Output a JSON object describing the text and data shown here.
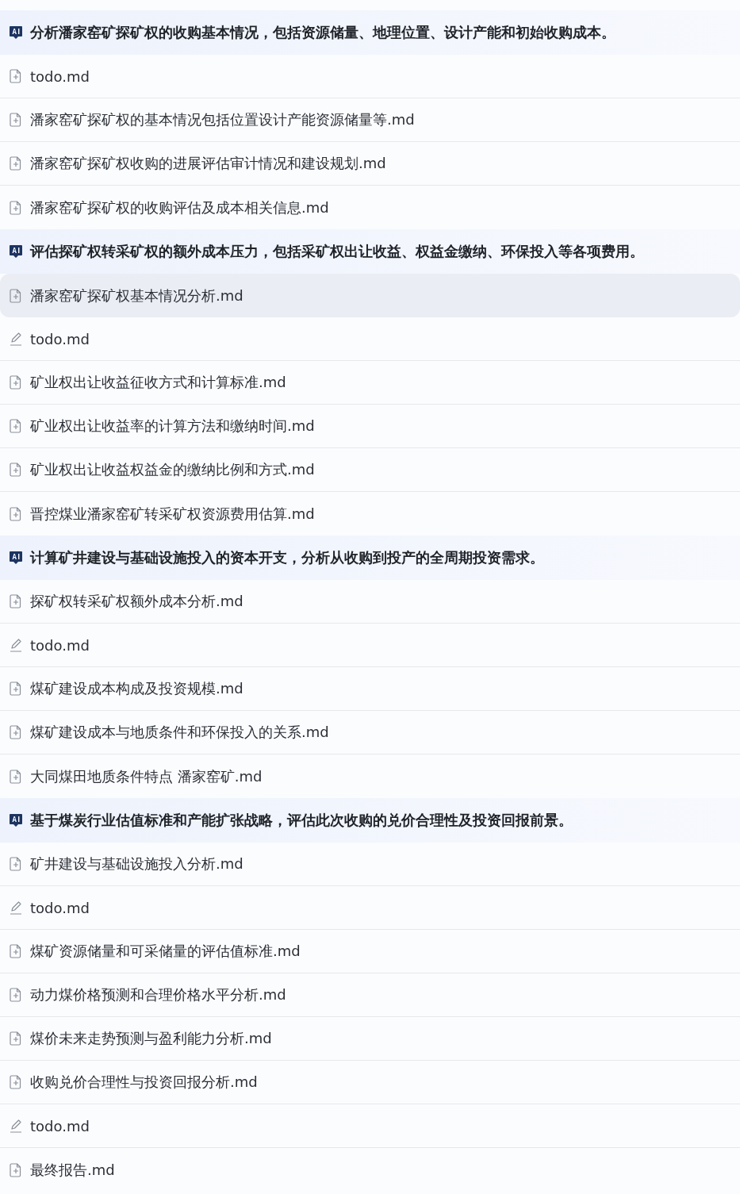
{
  "groups": [
    {
      "title": "分析潘家窑矿探矿权的收购基本情况，包括资源储量、地理位置、设计产能和初始收购成本。",
      "files": [
        {
          "name": "todo.md",
          "kind": "created",
          "selected": false
        },
        {
          "name": "潘家窑矿探矿权的基本情况包括位置设计产能资源储量等.md",
          "kind": "created",
          "selected": false
        },
        {
          "name": "潘家窑矿探矿权收购的进展评估审计情况和建设规划.md",
          "kind": "created",
          "selected": false
        },
        {
          "name": "潘家窑矿探矿权的收购评估及成本相关信息.md",
          "kind": "created",
          "selected": false
        }
      ]
    },
    {
      "title": "评估探矿权转采矿权的额外成本压力，包括采矿权出让收益、权益金缴纳、环保投入等各项费用。",
      "files": [
        {
          "name": "潘家窑矿探矿权基本情况分析.md",
          "kind": "created",
          "selected": true
        },
        {
          "name": "todo.md",
          "kind": "edited",
          "selected": false
        },
        {
          "name": "矿业权出让收益征收方式和计算标准.md",
          "kind": "created",
          "selected": false
        },
        {
          "name": "矿业权出让收益率的计算方法和缴纳时间.md",
          "kind": "created",
          "selected": false
        },
        {
          "name": "矿业权出让收益权益金的缴纳比例和方式.md",
          "kind": "created",
          "selected": false
        },
        {
          "name": "晋控煤业潘家窑矿转采矿权资源费用估算.md",
          "kind": "created",
          "selected": false
        }
      ]
    },
    {
      "title": "计算矿井建设与基础设施投入的资本开支，分析从收购到投产的全周期投资需求。",
      "files": [
        {
          "name": "探矿权转采矿权额外成本分析.md",
          "kind": "created",
          "selected": false
        },
        {
          "name": "todo.md",
          "kind": "edited",
          "selected": false
        },
        {
          "name": "煤矿建设成本构成及投资规模.md",
          "kind": "created",
          "selected": false
        },
        {
          "name": "煤矿建设成本与地质条件和环保投入的关系.md",
          "kind": "created",
          "selected": false
        },
        {
          "name": "大同煤田地质条件特点 潘家窑矿.md",
          "kind": "created",
          "selected": false
        }
      ]
    },
    {
      "title": "基于煤炭行业估值标准和产能扩张战略，评估此次收购的兑价合理性及投资回报前景。",
      "files": [
        {
          "name": "矿井建设与基础设施投入分析.md",
          "kind": "created",
          "selected": false
        },
        {
          "name": "todo.md",
          "kind": "edited",
          "selected": false
        },
        {
          "name": "煤矿资源储量和可采储量的评估值标准.md",
          "kind": "created",
          "selected": false
        },
        {
          "name": "动力煤价格预测和合理价格水平分析.md",
          "kind": "created",
          "selected": false
        },
        {
          "name": "煤价未来走势预测与盈利能力分析.md",
          "kind": "created",
          "selected": false
        },
        {
          "name": "收购兑价合理性与投资回报分析.md",
          "kind": "created",
          "selected": false
        },
        {
          "name": "todo.md",
          "kind": "edited",
          "selected": false
        },
        {
          "name": "最终报告.md",
          "kind": "created",
          "selected": false
        }
      ]
    }
  ]
}
